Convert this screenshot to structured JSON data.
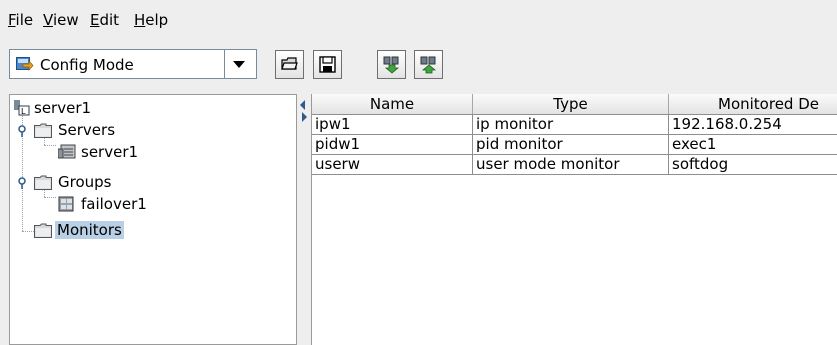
{
  "menu": [
    {
      "mnemonic": "F",
      "rest": "ile"
    },
    {
      "mnemonic": "V",
      "rest": "iew"
    },
    {
      "mnemonic": "E",
      "rest": "dit"
    },
    {
      "mnemonic": "H",
      "rest": "elp"
    }
  ],
  "toolbar": {
    "mode_selected": "Config Mode",
    "buttons": [
      "open-folder-icon",
      "save-disk-icon",
      "download-config-icon",
      "upload-config-icon"
    ]
  },
  "tree": {
    "root": "server1",
    "servers": "Servers",
    "server_item": "server1",
    "groups": "Groups",
    "group_item": "failover1",
    "monitors": "Monitors"
  },
  "table": {
    "columns": [
      "Name",
      "Type",
      "Monitored De"
    ],
    "rows": [
      [
        "ipw1",
        "ip monitor",
        "192.168.0.254"
      ],
      [
        "pidw1",
        "pid monitor",
        "exec1"
      ],
      [
        "userw",
        "user mode monitor",
        "softdog"
      ]
    ]
  },
  "colors": {
    "selection": "#b8cfe5",
    "background": "#eeeeee"
  }
}
